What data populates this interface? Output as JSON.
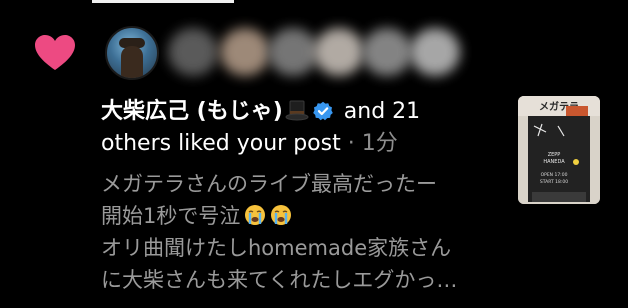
{
  "notification": {
    "name": "大柴広己 (もじゃ)",
    "action_line1": " and 21",
    "action_line2": "others liked your post",
    "separator": " · ",
    "time": "1分",
    "preview_lines": [
      "メガテラさんのライブ最高だったー",
      "開始1秒で号泣",
      "オリ曲聞けたしhomemade家族さん",
      "に大柴さんも来てくれたしエグかっ…"
    ],
    "thumbnail_labels": {
      "header": "メガテラ",
      "sign_line1": "ZEPP",
      "sign_line2": "HANEDA",
      "open": "OPEN 17:00",
      "start": "START 18:00"
    }
  },
  "colors": {
    "heart": "#ed4a82",
    "verified": "#3897f0",
    "muted_text": "#8e8e8e",
    "background": "#000000"
  },
  "icons": [
    "heart-icon",
    "top-hat-icon",
    "verified-badge-icon",
    "crying-face-icon"
  ]
}
